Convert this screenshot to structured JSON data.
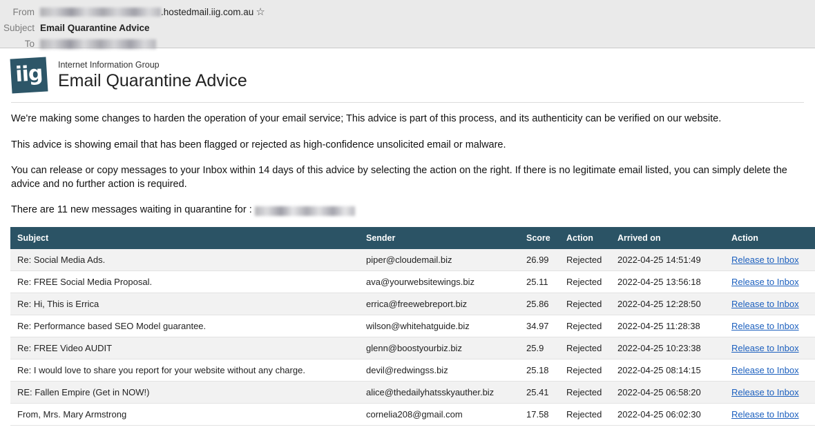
{
  "mail_header": {
    "from_label": "From",
    "from_redacted": true,
    "from_domain": ".hostedmail.iig.com.au",
    "star_icon": "star-outline-icon",
    "star_glyph": "☆",
    "subject_label": "Subject",
    "subject_value": "Email Quarantine Advice",
    "to_label": "To",
    "to_redacted": true
  },
  "brand": {
    "logo_text": "iig",
    "logo_color": "#2d5668",
    "org_name": "Internet Information Group",
    "title": "Email Quarantine Advice"
  },
  "body": {
    "paragraphs": [
      "We're making some changes to harden the operation of your email service; This advice is part of this process, and its authenticity can be verified on our website.",
      "This advice is showing email that has been flagged or rejected as high-confidence unsolicited email or malware.",
      "You can release or copy messages to your Inbox within 14 days of this advice by selecting the action on the right. If there is no legitimate email listed, you can simply delete the advice and no further action is required."
    ],
    "count_line_prefix": "There are 11 new messages waiting in quarantine for : ",
    "count": 11,
    "recipient_redacted": true
  },
  "table": {
    "header_color": "#2b5365",
    "columns": [
      "Subject",
      "Sender",
      "Score",
      "Action",
      "Arrived on",
      "Action"
    ],
    "rows": [
      {
        "subject": "Re: Social Media Ads.",
        "sender": "piper@cloudemail.biz",
        "score": "26.99",
        "action": "Rejected",
        "arrived": "2022-04-25 14:51:49",
        "release": "Release to Inbox"
      },
      {
        "subject": "Re: FREE Social Media Proposal.",
        "sender": "ava@yourwebsitewings.biz",
        "score": "25.11",
        "action": "Rejected",
        "arrived": "2022-04-25 13:56:18",
        "release": "Release to Inbox"
      },
      {
        "subject": "Re: Hi, This is Errica",
        "sender": "errica@freewebreport.biz",
        "score": "25.86",
        "action": "Rejected",
        "arrived": "2022-04-25 12:28:50",
        "release": "Release to Inbox"
      },
      {
        "subject": "Re: Performance based SEO Model guarantee.",
        "sender": "wilson@whitehatguide.biz",
        "score": "34.97",
        "action": "Rejected",
        "arrived": "2022-04-25 11:28:38",
        "release": "Release to Inbox"
      },
      {
        "subject": "Re: FREE Video AUDIT",
        "sender": "glenn@boostyourbiz.biz",
        "score": "25.9",
        "action": "Rejected",
        "arrived": "2022-04-25 10:23:38",
        "release": "Release to Inbox"
      },
      {
        "subject": "Re: I would love to share you report for your website without any charge.",
        "sender": "devil@redwingss.biz",
        "score": "25.18",
        "action": "Rejected",
        "arrived": "2022-04-25 08:14:15",
        "release": "Release to Inbox"
      },
      {
        "subject": "RE: Fallen Empire (Get in NOW!)",
        "sender": "alice@thedailyhatsskyauther.biz",
        "score": "25.41",
        "action": "Rejected",
        "arrived": "2022-04-25 06:58:20",
        "release": "Release to Inbox"
      },
      {
        "subject": "From, Mrs. Mary Armstrong",
        "sender": "cornelia208@gmail.com",
        "score": "17.58",
        "action": "Rejected",
        "arrived": "2022-04-25 06:02:30",
        "release": "Release to Inbox"
      }
    ]
  }
}
